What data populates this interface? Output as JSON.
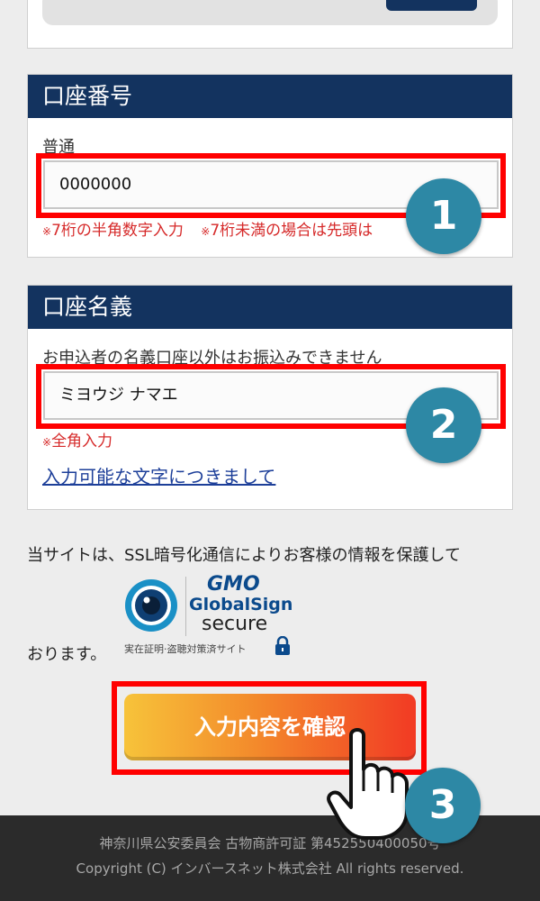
{
  "account_number": {
    "header": "口座番号",
    "type_label": "普通",
    "input_value": "0000000",
    "note_1": "7桁の半角数字入力",
    "note_2": "7桁未満の場合は先頭は"
  },
  "account_name": {
    "header": "口座名義",
    "instruction": "お申込者の名義口座以外はお振込みできません",
    "input_value": "ミヨウジ ナマエ",
    "note": "全角入力",
    "link": "入力可能な文字につきまして"
  },
  "security": {
    "text_1": "当サイトは、SSL暗号化通信によりお客様の情報を保護して",
    "text_2": "おります。",
    "badge_gmo": "GMO",
    "badge_name": "GlobalSign",
    "badge_secure": "secure",
    "badge_sub": "実在証明·盗聴対策済サイト"
  },
  "confirm_button": "入力内容を確認",
  "steps": [
    "1",
    "2",
    "3"
  ],
  "footer": {
    "license": "神奈川県公安委員会 古物商許可証 第452550400050号",
    "copyright": "Copyright (C) インバースネット株式会社 All rights reserved."
  },
  "colors": {
    "header_navy": "#13335f",
    "highlight_red": "#ff0000",
    "step_teal": "#2d88a5",
    "note_red": "#d62a2a"
  }
}
